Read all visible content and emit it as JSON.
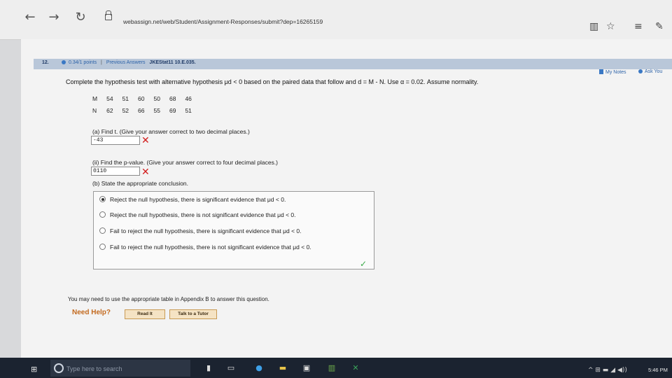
{
  "browser": {
    "back_icon": "←",
    "forward_icon": "→",
    "refresh_icon": "↻",
    "url": "webassign.net/web/Student/Assignment-Responses/submit?dep=16265159",
    "reading_icon": "▥",
    "favorite_icon": "☆",
    "hub_icon": "≡",
    "note_icon": "✎"
  },
  "question": {
    "number": "12.",
    "points": "0.34/1 points",
    "separator": "|",
    "previous_answers": "Previous Answers",
    "code": "JKEStat11 10.E.035.",
    "my_notes": "My Notes",
    "ask_your": "Ask You",
    "prompt": "Complete the hypothesis test with alternative hypothesis μd < 0 based on the paired data that follow and d = M - N. Use α = 0.02. Assume normality.",
    "table": [
      [
        "M",
        "54",
        "51",
        "60",
        "50",
        "68",
        "46"
      ],
      [
        "N",
        "62",
        "52",
        "66",
        "55",
        "69",
        "51"
      ]
    ],
    "part_a_label": "(a) Find t. (Give your answer correct to two decimal places.)",
    "part_a_value": "-43",
    "part_a_mark": "✕",
    "part_ii_label": "(ii) Find the p-value. (Give your answer correct to four decimal places.)",
    "part_ii_value": "0110",
    "part_ii_mark": "✕",
    "part_b_label": "(b) State the appropriate conclusion.",
    "choices": [
      "Reject the null hypothesis, there is significant evidence that μd < 0.",
      "Reject the null hypothesis, there is not significant evidence that μd < 0.",
      "Fail to reject the null hypothesis, there is significant evidence that μd < 0.",
      "Fail to reject the null hypothesis, there is not significant evidence that μd < 0."
    ],
    "selected_choice": 0,
    "correct_mark": "✓",
    "appendix_note": "You may need to use the appropriate table in Appendix B to answer this question.",
    "need_help": "Need Help?",
    "read_it": "Read It",
    "talk_to_tutor": "Talk to a Tutor"
  },
  "taskbar": {
    "start_icon": "⊞",
    "search_placeholder": "Type here to search",
    "tray_icons": "^ ⊞ ▬ ◢ ◀))",
    "time": "5:46 PM"
  },
  "colors": {
    "question_bar": "#b9c7d9",
    "wrong": "#d21c1c",
    "correct": "#3cab4a",
    "help_orange": "#c36a1f"
  }
}
